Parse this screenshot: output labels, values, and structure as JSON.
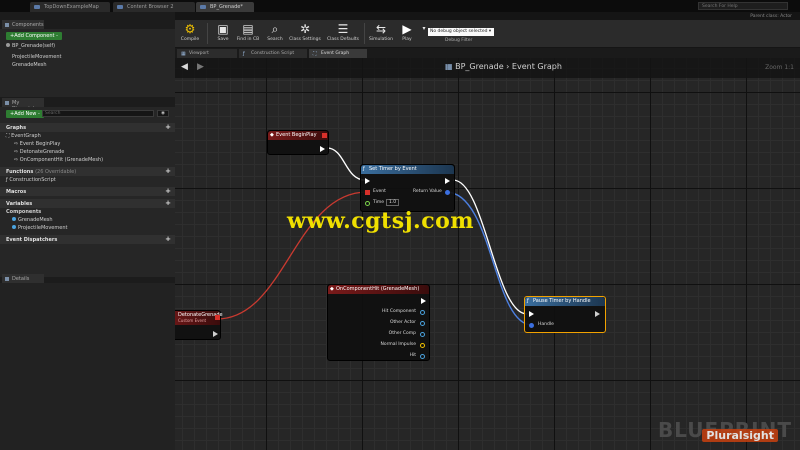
{
  "tabs": [
    {
      "label": "TopDownExampleMap"
    },
    {
      "label": "Content Browser 2"
    },
    {
      "label": "BP_Grenade*"
    }
  ],
  "search_help": "Search For Help",
  "parent_class": "Parent class: Actor",
  "components_panel": {
    "tab": "Components",
    "add_button": "+Add Component -",
    "self_item": "BP_Grenade(self)",
    "items": [
      "ProjectileMovement",
      "GrenadeMesh"
    ]
  },
  "my_blueprint": {
    "tab": "My Blueprint",
    "add_button": "+Add New -",
    "search_placeholder": "Search",
    "graphs_header": "Graphs",
    "graph_items": [
      "EventGraph",
      "Event BeginPlay",
      "DetonateGrenade",
      "OnComponentHit (GrenadeMesh)"
    ],
    "functions_header": "Functions",
    "functions_overridable": "(26 Overridable)",
    "function_items": [
      "ConstructionScript"
    ],
    "macros_header": "Macros",
    "variables_header": "Variables",
    "components_header": "Components",
    "variable_items": [
      "GrenadeMesh",
      "ProjectileMovement"
    ],
    "dispatchers_header": "Event Dispatchers"
  },
  "details_panel": {
    "tab": "Details"
  },
  "toolbar": {
    "buttons": [
      "Compile",
      "Save",
      "Find in CB",
      "Search",
      "Class Settings",
      "Class Defaults",
      "Simulation",
      "Play"
    ],
    "debug_select": "No debug object selected",
    "debug_filter": "Debug Filter"
  },
  "graph_tabs": [
    "Viewport",
    "Construction Script",
    "Event Graph"
  ],
  "graph": {
    "breadcrumb": "BP_Grenade › Event Graph",
    "zoom": "Zoom 1:1",
    "nodes": {
      "begin_play": {
        "title": "Event BeginPlay"
      },
      "set_timer": {
        "title": "Set Timer by Event",
        "event_pin": "Event",
        "time_pin": "Time",
        "time_value": "1.0",
        "return_pin": "Return Value"
      },
      "pause_timer": {
        "title": "Pause Timer by Handle",
        "handle_pin": "Handle"
      },
      "detonate": {
        "title": "DetonateGrenade",
        "subtitle": "Custom Event"
      },
      "on_hit": {
        "title": "OnComponentHit (GrenadeMesh)",
        "pins": [
          "Hit Component",
          "Other Actor",
          "Other Comp",
          "Normal Impulse",
          "Hit"
        ]
      }
    }
  },
  "watermark": "www.cgtsj.com",
  "brand_watermark": "BLUEPRINT",
  "brand_badge": "Pluralsight"
}
